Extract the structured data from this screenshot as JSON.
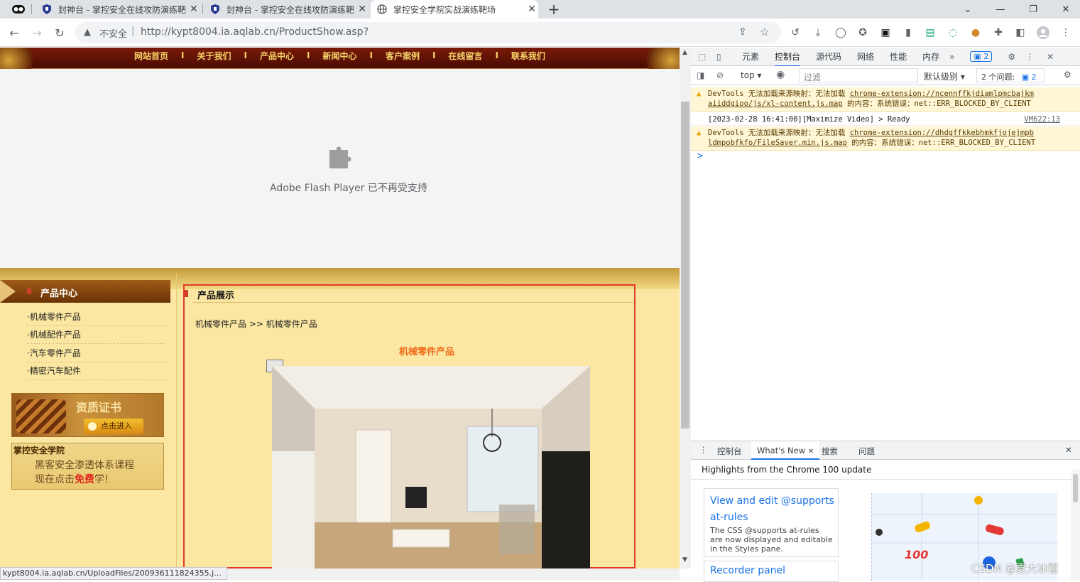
{
  "tabs": [
    {
      "title": "封神台 - 掌控安全在线攻防演练靶"
    },
    {
      "title": "封神台 - 掌控安全在线攻防演练靶"
    },
    {
      "title": "掌控安全学院实战演练靶场"
    }
  ],
  "toolbar": {
    "insecure": "不安全",
    "url": "http://kypt8004.ia.aqlab.cn/ProductShow.asp?"
  },
  "site": {
    "nav": [
      "网站首页",
      "关于我们",
      "产品中心",
      "新闻中心",
      "客户案例",
      "在线留言",
      "联系我们"
    ],
    "nav_sep": "I",
    "flash_text": "Adobe Flash Player 已不再受支持",
    "sidebar_title": "产品中心",
    "sidebar_items": [
      "·机械零件产品",
      "·机械配件产品",
      "·汽车零件产品",
      "·精密汽车配件"
    ],
    "cert_title": "资质证书",
    "cert_btn": "点击进入",
    "ad_title": "掌控安全学院",
    "ad_line1": "黑客安全渗透体系课程",
    "ad_line2_a": "现在点击",
    "ad_line2_b": "免费",
    "ad_line2_c": "学!",
    "prod_header": "产品展示",
    "breadcrumb": "机械零件产品 >> 机械零件产品",
    "prod_name": "机械零件产品"
  },
  "status_url": "kypt8004.ia.aqlab.cn/UploadFiles/200936111824355.j...",
  "devtools": {
    "tabs": [
      "元素",
      "控制台",
      "源代码",
      "网络",
      "性能",
      "内存"
    ],
    "issue_badge": "2",
    "filter": {
      "context": "top",
      "placeholder": "过滤",
      "levels": "默认级别",
      "issues": "2 个问题:",
      "issues_count": "2"
    },
    "msgs": [
      {
        "type": "warn",
        "line1_a": "DevTools 无法加载来源映射：无法加载 ",
        "line1_link": "chrome-extension://ncennffkjdiamlpmcbajkm",
        "line2_link": "aiiddgioo/js/xl-content.js.map",
        "line2_b": " 的内容：系统错误：net::ERR_BLOCKED_BY_CLIENT"
      },
      {
        "type": "log",
        "text": "[2023-02-28 16:41:00][Maximize Video] > Ready",
        "src": "VM622:13"
      },
      {
        "type": "warn",
        "line1_a": "DevTools 无法加载来源映射：无法加载 ",
        "line1_link": "chrome-extension://dhdgffkkebhmkfjojejmpb",
        "line2_link": "ldmpobfkfo/FileSaver.min.js.map",
        "line2_b": " 的内容：系统错误：net::ERR_BLOCKED_BY_CLIENT"
      }
    ],
    "prompt": ">",
    "drawer": {
      "tabs": [
        "控制台",
        "What's New",
        "搜索",
        "问题"
      ],
      "headline": "Highlights from the Chrome 100 update",
      "card1_title_a": "View and edit @supports",
      "card1_title_b": "at-rules",
      "card1_desc": "The CSS @supports at-rules are now displayed and editable in the Styles pane.",
      "card2_title": "Recorder panel"
    }
  },
  "watermark": "CSDN @夏大冰雹"
}
